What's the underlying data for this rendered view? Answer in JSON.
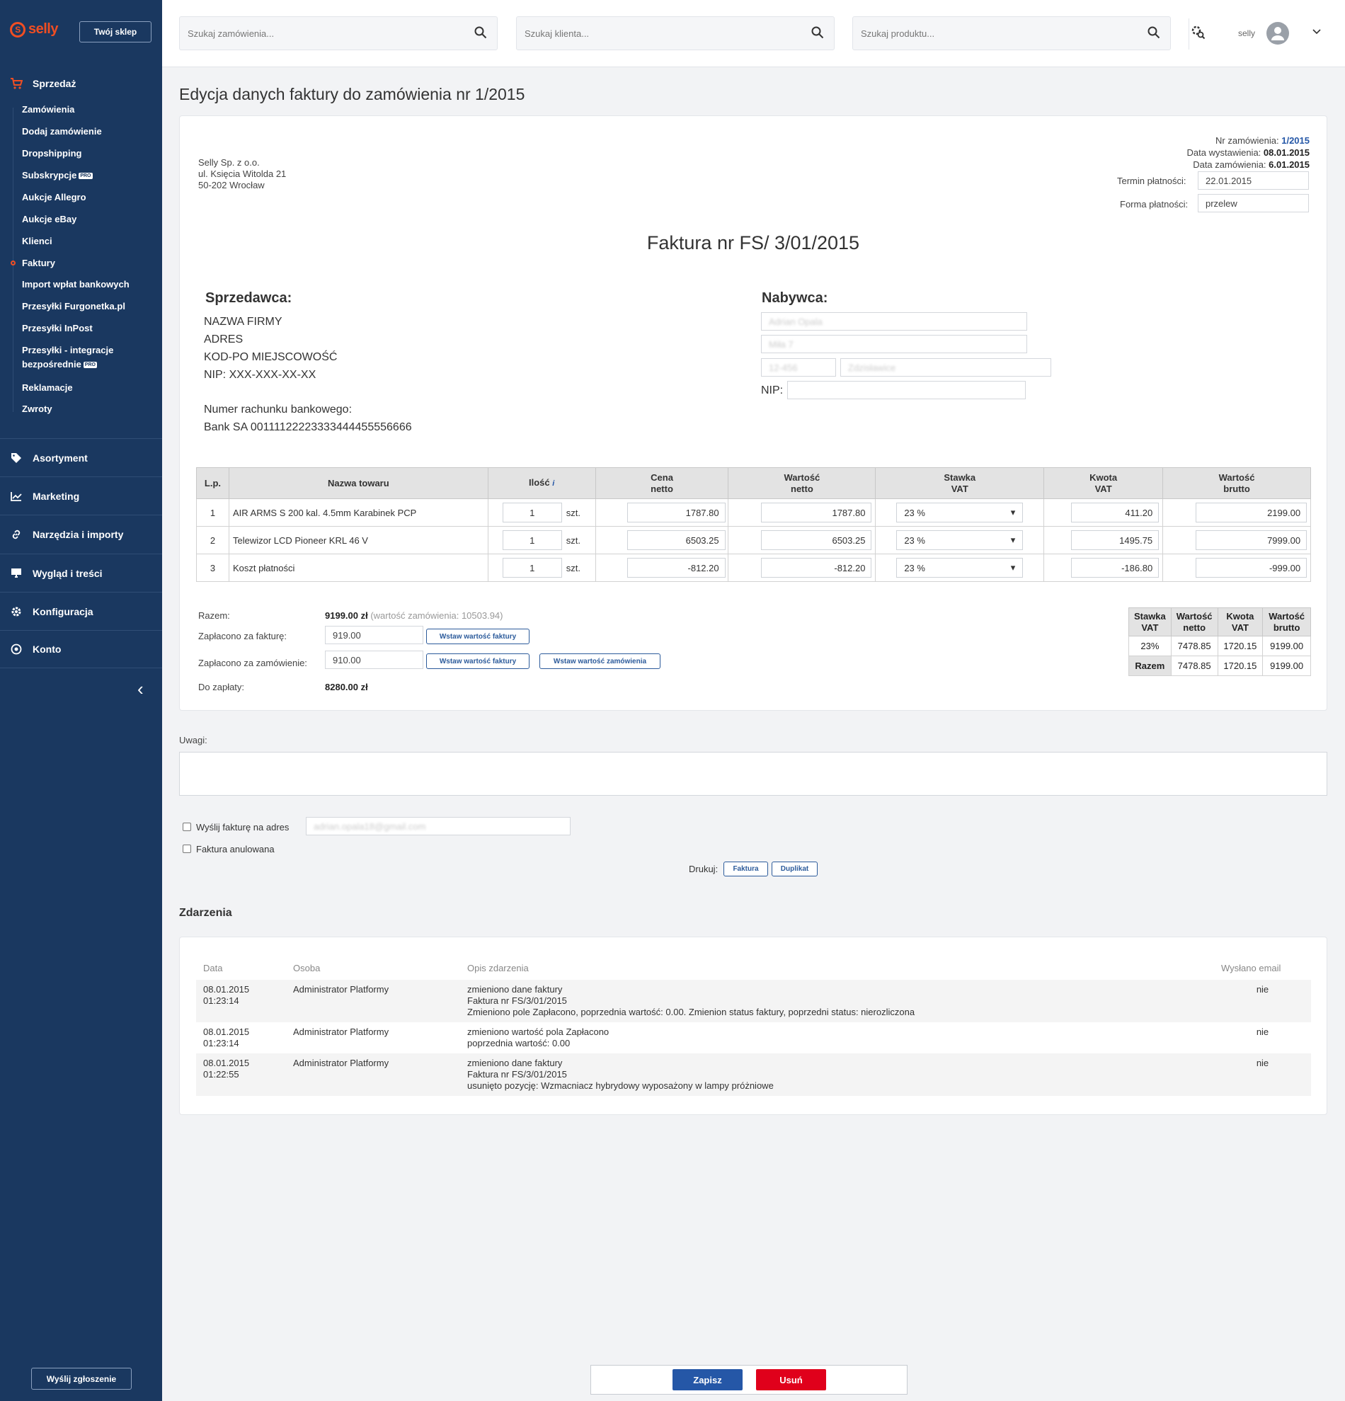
{
  "sidebar": {
    "logo": "selly",
    "shop_button": "Twój sklep",
    "sales_heading": "Sprzedaż",
    "sales_items": [
      "Zamówienia",
      "Dodaj zamówienie",
      "Dropshipping",
      "Subskrypcje",
      "Aukcje Allegro",
      "Aukcje eBay",
      "Klienci",
      "Faktury",
      "Import wpłat bankowych",
      "Przesyłki Furgonetka.pl",
      "Przesyłki InPost",
      "Przesyłki - integracje",
      "bezpośrednie",
      "Reklamacje",
      "Zwroty"
    ],
    "pro_badge": "PRO",
    "sections": [
      "Asortyment",
      "Marketing",
      "Narzędzia i importy",
      "Wygląd i treści",
      "Konfiguracja",
      "Konto"
    ],
    "report_button": "Wyślij zgłoszenie",
    "active_item": "Faktury"
  },
  "topbar": {
    "search_orders": "Szukaj zamówienia...",
    "search_clients": "Szukaj klienta...",
    "search_products": "Szukaj produktu...",
    "user": "selly"
  },
  "page": {
    "title": "Edycja danych faktury do zamówienia nr 1/2015"
  },
  "invoice": {
    "company": [
      "Selly Sp. z o.o.",
      "ul. Księcia Witolda 21",
      "50-202 Wrocław"
    ],
    "order_no_label": "Nr zamówienia:",
    "order_no": "1/2015",
    "issue_date_label": "Data wystawienia:",
    "issue_date": "08.01.2015",
    "order_date_label": "Data zamówienia:",
    "order_date": "6.01.2015",
    "due_label": "Termin płatności:",
    "due_value": "22.01.2015",
    "payment_label": "Forma płatności:",
    "payment_value": "przelew",
    "heading": "Faktura nr FS/ 3/01/2015",
    "seller_heading": "Sprzedawca:",
    "seller_lines": [
      "NAZWA FIRMY",
      "ADRES",
      "KOD-PO MIEJSCOWOŚĆ",
      "NIP: XXX-XXX-XX-XX"
    ],
    "bank_label": "Numer rachunku bankowego:",
    "bank_value": "Bank SA 00111122223333444455556666",
    "buyer_heading": "Nabywca:",
    "buyer_name": "Adrian Opala",
    "buyer_street": "Miła 7",
    "buyer_zip": "12-456",
    "buyer_city": "Zdzisławice",
    "nip_label": "NIP:"
  },
  "items": {
    "headers": [
      "L.p.",
      "Nazwa towaru",
      "Ilość",
      "Cena netto",
      "Wartość netto",
      "Stawka VAT",
      "Kwota VAT",
      "Wartość brutto"
    ],
    "unit": "szt.",
    "rows": [
      {
        "lp": "1",
        "name": "AIR ARMS S 200 kal. 4.5mm Karabinek PCP",
        "qty": "1",
        "price": "1787.80",
        "net": "1787.80",
        "vat": "23 %",
        "vat_amount": "411.20",
        "gross": "2199.00"
      },
      {
        "lp": "2",
        "name": "Telewizor LCD Pioneer KRL 46 V",
        "qty": "1",
        "price": "6503.25",
        "net": "6503.25",
        "vat": "23 %",
        "vat_amount": "1495.75",
        "gross": "7999.00"
      },
      {
        "lp": "3",
        "name": "Koszt płatności",
        "qty": "1",
        "price": "-812.20",
        "net": "-812.20",
        "vat": "23 %",
        "vat_amount": "-186.80",
        "gross": "-999.00"
      }
    ]
  },
  "totals": {
    "sum_label": "Razem:",
    "sum_value": "9199.00 zł",
    "sum_note": "(wartość zamówienia: 10503.94)",
    "paid_invoice_label": "Zapłacono za fakturę:",
    "paid_invoice_value": "919.00",
    "paid_order_label": "Zapłacono za zamówienie:",
    "paid_order_value": "910.00",
    "insert_invoice_btn": "Wstaw wartość faktury",
    "insert_order_btn": "Wstaw wartość zamówienia",
    "to_pay_label": "Do zapłaty:",
    "to_pay_value": "8280.00 zł"
  },
  "vat_summary": {
    "headers": [
      "Stawka VAT",
      "Wartość netto",
      "Kwota VAT",
      "Wartość brutto"
    ],
    "rows": [
      [
        "23%",
        "7478.85",
        "1720.15",
        "9199.00"
      ],
      [
        "Razem",
        "7478.85",
        "1720.15",
        "9199.00"
      ]
    ]
  },
  "notes": {
    "label": "Uwagi:",
    "send_label": "Wyślij fakturę na adres",
    "email": "adrian.opala18@gmail.com",
    "cancelled_label": "Faktura anulowana",
    "print_label": "Drukuj:",
    "print_invoice": "Faktura",
    "print_duplicate": "Duplikat"
  },
  "events": {
    "heading": "Zdarzenia",
    "headers": [
      "Data",
      "Osoba",
      "Opis zdarzenia",
      "Wysłano email"
    ],
    "rows": [
      {
        "date": "08.01.2015",
        "time": "01:23:14",
        "person": "Administrator Platformy",
        "desc": [
          "zmieniono dane faktury",
          "Faktura nr FS/3/01/2015",
          "Zmieniono pole Zapłacono, poprzednia wartość: 0.00. Zmienion status faktury, poprzedni status: nierozliczona"
        ],
        "email": "nie"
      },
      {
        "date": "08.01.2015",
        "time": "01:23:14",
        "person": "Administrator Platformy",
        "desc": [
          "zmieniono wartość pola Zapłacono",
          "poprzednia wartość: 0.00"
        ],
        "email": "nie"
      },
      {
        "date": "08.01.2015",
        "time": "01:22:55",
        "person": "Administrator Platformy",
        "desc": [
          "zmieniono dane faktury",
          "Faktura nr FS/3/01/2015",
          "usunięto pozycję: Wzmacniacz hybrydowy wyposażony w lampy próżniowe"
        ],
        "email": "nie"
      }
    ]
  },
  "actions": {
    "save": "Zapisz",
    "delete": "Usuń"
  },
  "colors": {
    "sidebar": "#1a3860",
    "accent": "#f04e23",
    "primary": "#2557a7",
    "danger": "#e0001b"
  }
}
